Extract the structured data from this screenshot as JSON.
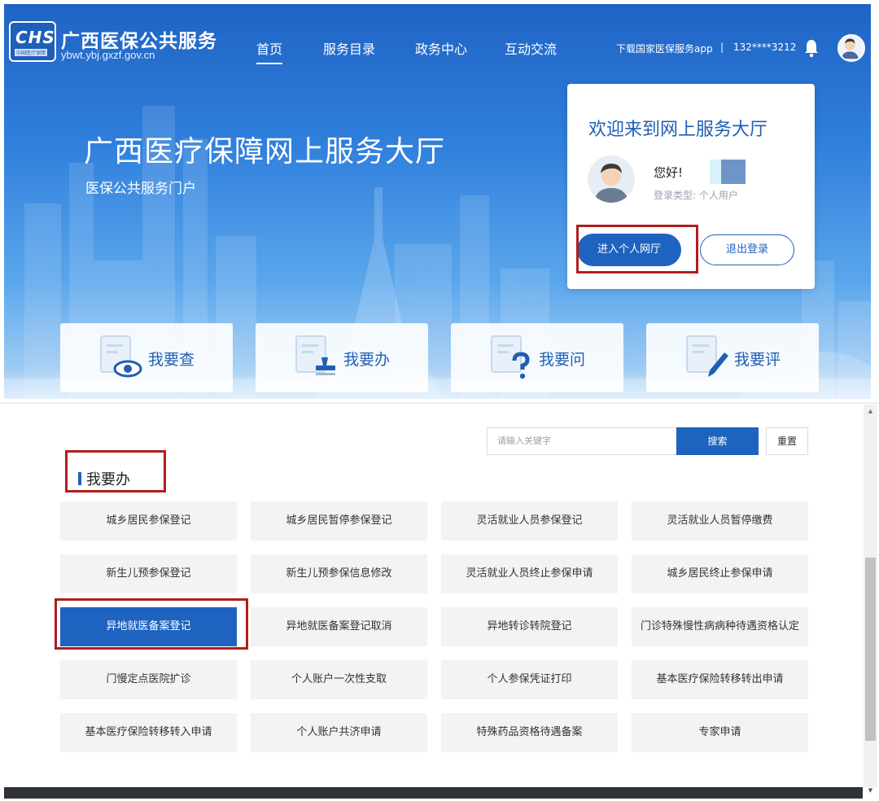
{
  "header": {
    "brand_title": "广西医保公共服务",
    "brand_url": "ybwt.ybj.gxzf.gov.cn",
    "logo_text": "CHS",
    "logo_sub": "中国医疗保障",
    "nav": [
      "首页",
      "服务目录",
      "政务中心",
      "互动交流"
    ],
    "download_app": "下载国家医保服务app",
    "divider": "|",
    "phone": "132****3212"
  },
  "hero": {
    "title": "广西医疗保障网上服务大厅",
    "subtitle": "医保公共服务门户"
  },
  "welcome": {
    "title": "欢迎来到网上服务大厅",
    "greeting": "您好!",
    "login_type": "登录类型: 个人用户",
    "enter_button": "进入个人网厅",
    "logout_button": "退出登录"
  },
  "quick_actions": [
    "我要查",
    "我要办",
    "我要问",
    "我要评"
  ],
  "search": {
    "placeholder": "请输入关键字",
    "search_button": "搜索",
    "reset_button": "重置"
  },
  "section_title": "我要办",
  "services": [
    [
      "城乡居民参保登记",
      "城乡居民暂停参保登记",
      "灵活就业人员参保登记",
      "灵活就业人员暂停缴费"
    ],
    [
      "新生儿预参保登记",
      "新生儿预参保信息修改",
      "灵活就业人员终止参保申请",
      "城乡居民终止参保申请"
    ],
    [
      "异地就医备案登记",
      "异地就医备案登记取消",
      "异地转诊转院登记",
      "门诊特殊慢性病病种待遇资格认定"
    ],
    [
      "门慢定点医院扩诊",
      "个人账户一次性支取",
      "个人参保凭证打印",
      "基本医疗保险转移转出申请"
    ],
    [
      "基本医疗保险转移转入申请",
      "个人账户共济申请",
      "特殊药品资格待遇备案",
      "专家申请"
    ]
  ],
  "colors": {
    "primary": "#1e63bf",
    "highlight": "#b01e1e"
  },
  "icons": [
    "bell-icon",
    "user-avatar-icon",
    "eye-doc-icon",
    "stamp-doc-icon",
    "question-doc-icon",
    "pen-doc-icon"
  ]
}
